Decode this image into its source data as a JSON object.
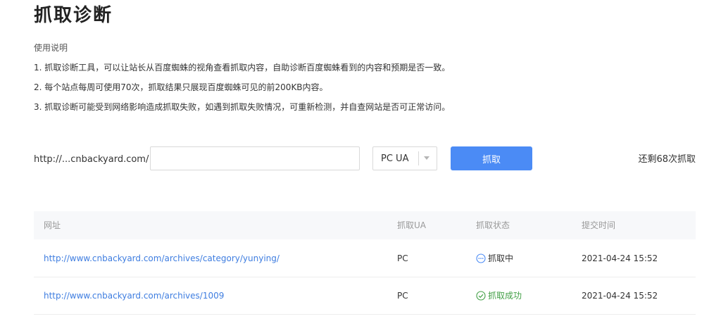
{
  "page": {
    "title": "抓取诊断"
  },
  "usage": {
    "heading": "使用说明",
    "lines": [
      "1. 抓取诊断工具，可以让站长从百度蜘蛛的视角查看抓取内容，自助诊断百度蜘蛛看到的内容和预期是否一致。",
      "2. 每个站点每周可使用70次，抓取结果只展现百度蜘蛛可见的前200KB内容。",
      "3. 抓取诊断可能受到网络影响造成抓取失败，如遇到抓取失败情况，可重新检测，并自查网站是否可正常访问。"
    ]
  },
  "fetch_form": {
    "url_prefix": "http://...cnbackyard.com/",
    "url_value": "",
    "ua_selected": "PC UA",
    "button_label": "抓取",
    "remaining": "还剩68次抓取"
  },
  "table": {
    "headers": {
      "url": "网址",
      "ua": "抓取UA",
      "status": "抓取状态",
      "time": "提交时间"
    },
    "rows": [
      {
        "url": "http://www.cnbackyard.com/archives/category/yunying/",
        "ua": "PC",
        "status": "抓取中",
        "status_icon": "ellipsis-circle-icon",
        "time": "2021-04-24 15:52"
      },
      {
        "url": "http://www.cnbackyard.com/archives/1009",
        "ua": "PC",
        "status": "抓取成功",
        "status_icon": "check-circle-icon",
        "time": "2021-04-24 15:52"
      }
    ]
  },
  "colors": {
    "primary": "#4b8bf5",
    "link": "#3e7de0",
    "success": "#43a047",
    "header_bg": "#f7f8fa"
  }
}
